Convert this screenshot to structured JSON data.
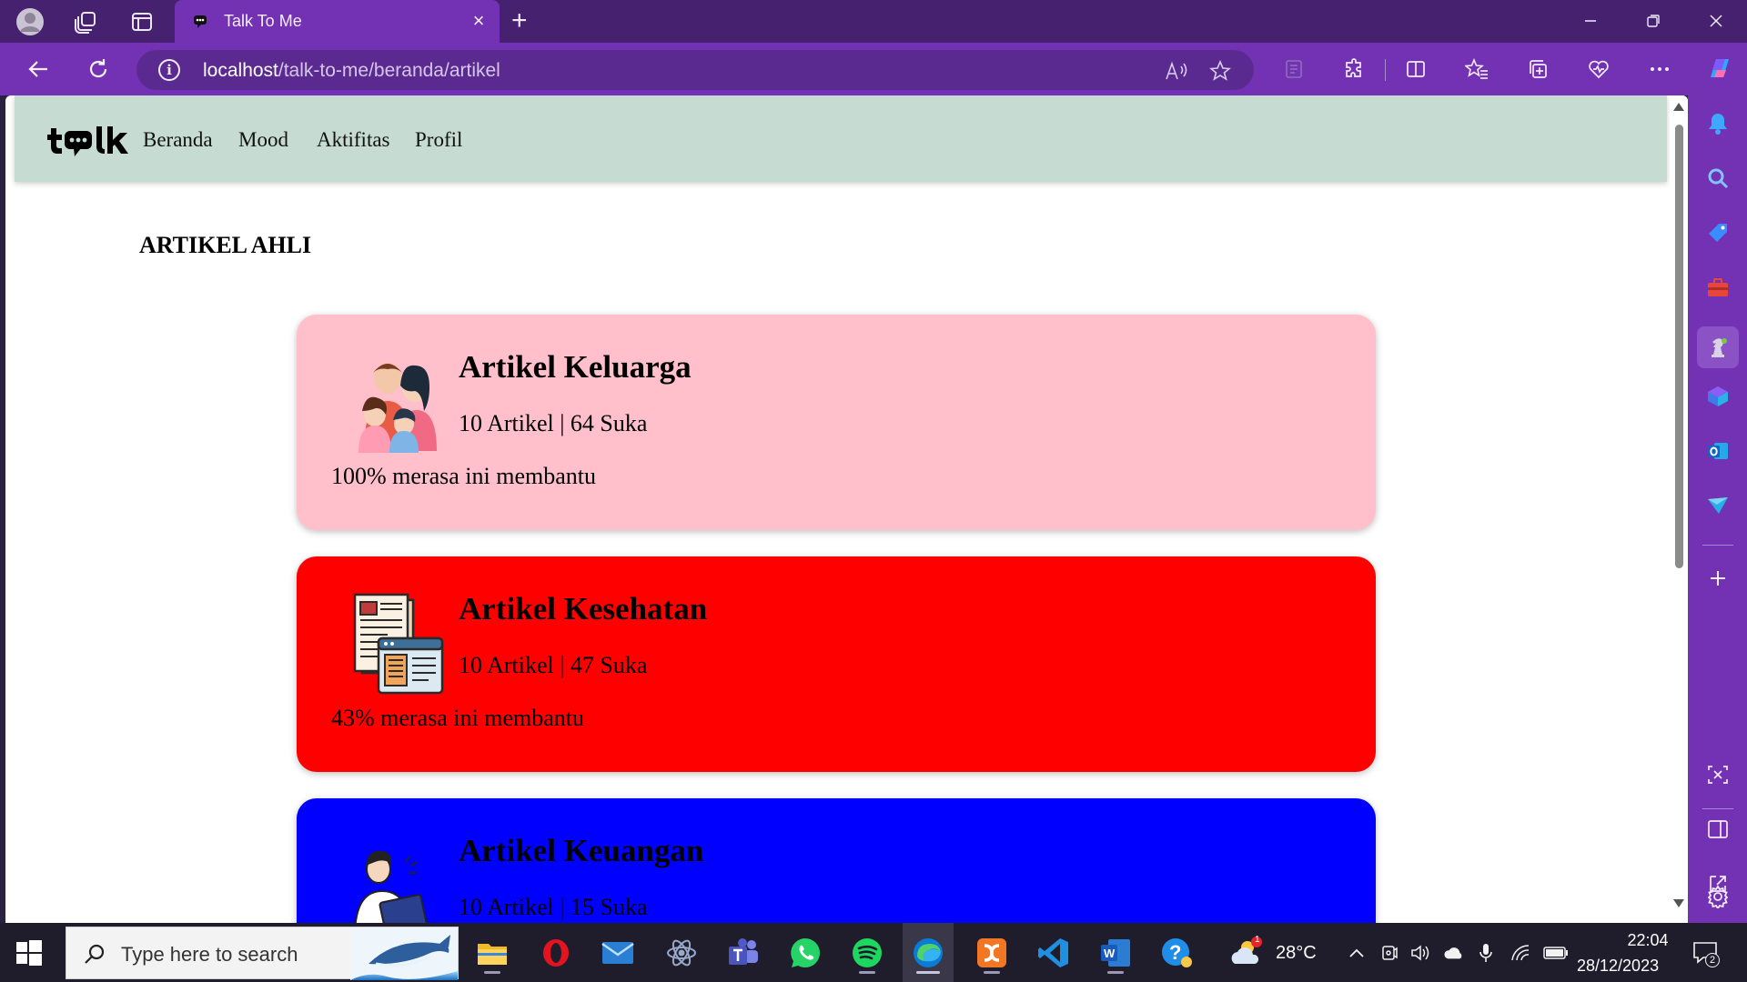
{
  "browser": {
    "tab_title": "Talk To Me",
    "new_tab_symbol": "+",
    "tab_close_symbol": "×",
    "url_host": "localhost",
    "url_path": "/talk-to-me/beranda/artikel",
    "accent_color": "#7332b3",
    "titlebar_color": "#46216f"
  },
  "site": {
    "nav_bg": "#c6dcd2",
    "logo_alt": "talk",
    "menu": [
      {
        "label": "Beranda"
      },
      {
        "label": "Mood"
      },
      {
        "label": "Aktifitas"
      },
      {
        "label": "Profil"
      }
    ],
    "page_title": "ARTIKEL AHLI",
    "cards": [
      {
        "title": "Artikel Keluarga",
        "stats": "10 Artikel | 64 Suka",
        "helpful": "100% merasa ini membantu",
        "bg": "#ffc0cb",
        "icon": "family-icon"
      },
      {
        "title": "Artikel Kesehatan",
        "stats": "10 Artikel | 47 Suka",
        "helpful": "43% merasa ini membantu",
        "bg": "#ff0000",
        "icon": "newspaper-icon"
      },
      {
        "title": "Artikel Keuangan",
        "stats": "10 Artikel | 15 Suka",
        "helpful": "",
        "bg": "#0000ff",
        "icon": "person-laptop-icon"
      }
    ]
  },
  "taskbar": {
    "search_placeholder": "Type here to search",
    "weather_temp": "28°C",
    "weather_badge": "1",
    "clock_time": "22:04",
    "clock_date": "28/12/2023",
    "notification_count": "2"
  }
}
